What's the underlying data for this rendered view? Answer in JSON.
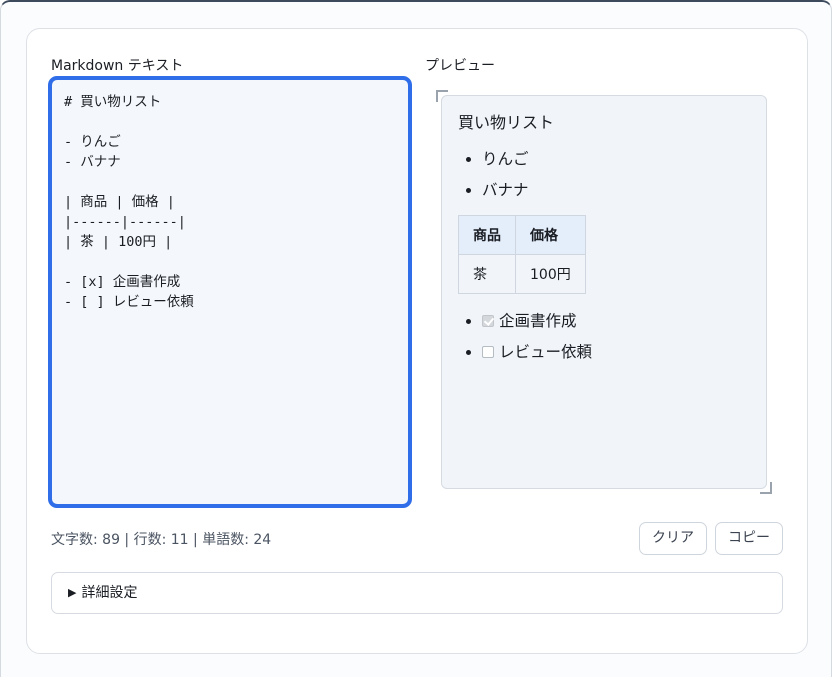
{
  "editor": {
    "label": "Markdown テキスト",
    "content": "# 買い物リスト\n\n- りんご\n- バナナ\n\n| 商品 | 価格 |\n|------|------|\n| 茶 | 100円 |\n\n- [x] 企画書作成\n- [ ] レビュー依頼"
  },
  "preview": {
    "label": "プレビュー",
    "heading": "買い物リスト",
    "list": [
      "りんご",
      "バナナ"
    ],
    "table": {
      "headers": [
        "商品",
        "価格"
      ],
      "rows": [
        [
          "茶",
          "100円"
        ]
      ]
    },
    "tasks": [
      {
        "label": "企画書作成",
        "checked": true
      },
      {
        "label": "レビュー依頼",
        "checked": false
      }
    ]
  },
  "stats": {
    "text": "文字数: 89 | 行数: 11 | 単語数: 24"
  },
  "buttons": {
    "clear": "クリア",
    "copy": "コピー"
  },
  "details": {
    "summary": "詳細設定"
  },
  "colors": {
    "accent": "#2f6ee8",
    "table_header": "#e4eefb"
  }
}
